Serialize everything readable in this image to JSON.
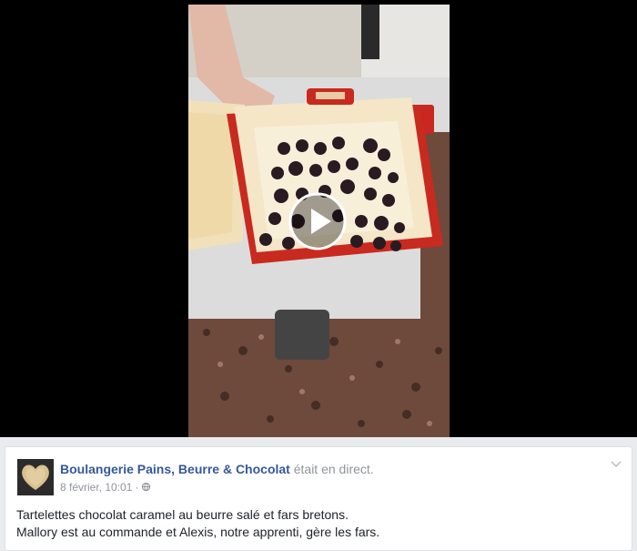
{
  "video": {
    "play_icon": "play-icon"
  },
  "post": {
    "page_name": "Boulangerie Pains, Beurre & Chocolat",
    "live_status": "était en direct.",
    "timestamp": "8 février, 10:01",
    "separator": "·",
    "audience_icon": "public-globe-icon",
    "menu_icon": "chevron-down-icon",
    "text_lines": [
      "Tartelettes chocolat caramel au beurre salé et fars bretons.",
      "Mallory est au commande et Alexis, notre apprenti, gère les fars."
    ]
  }
}
